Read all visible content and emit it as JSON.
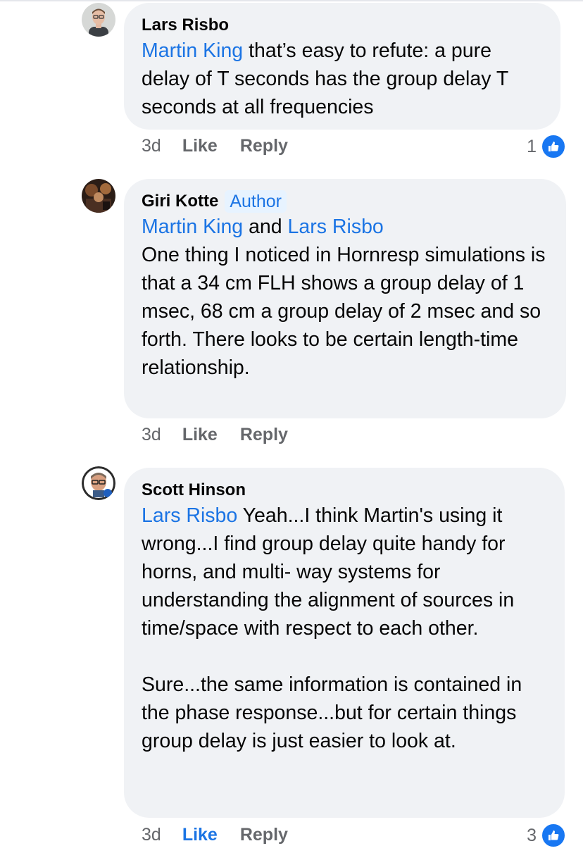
{
  "comments": [
    {
      "author": "Lars Risbo",
      "badge": "",
      "mentions": [
        "Martin King"
      ],
      "text_after_mentions": " that’s easy to refute: a pure delay of T seconds has the group delay T seconds at all frequencies",
      "time": "3d",
      "like_label": "Like",
      "reply_label": "Reply",
      "reactions": "1",
      "liked": false
    },
    {
      "author": "Giri Kotte",
      "badge": "Author",
      "mention_1": "Martin King",
      "connector": " and ",
      "mention_2": "Lars Risbo",
      "text": "One thing I noticed in Hornresp simulations is that a 34 cm FLH shows a group delay of 1 msec, 68 cm a group delay of 2 msec and so forth. There looks to be certain length-time relationship.",
      "time": "3d",
      "like_label": "Like",
      "reply_label": "Reply",
      "liked": false
    },
    {
      "author": "Scott Hinson",
      "badge": "",
      "mention": "Lars Risbo",
      "text_after_mention": " Yeah...I think Martin's using it wrong...I find group delay quite handy for horns, and multi- way systems for understanding the alignment of sources in time/space with respect to each other.",
      "text_para_2": "Sure...the same information is contained in the phase response...but for certain things group delay is just easier to look at.",
      "time": "3d",
      "like_label": "Like",
      "reply_label": "Reply",
      "reactions": "3",
      "liked": true
    }
  ],
  "colors": {
    "link": "#1b74e4",
    "bubble": "#f0f2f5",
    "meta": "#65676b",
    "like_badge": "#1877f2"
  },
  "icons": {
    "reaction": "thumbs-up-icon"
  }
}
